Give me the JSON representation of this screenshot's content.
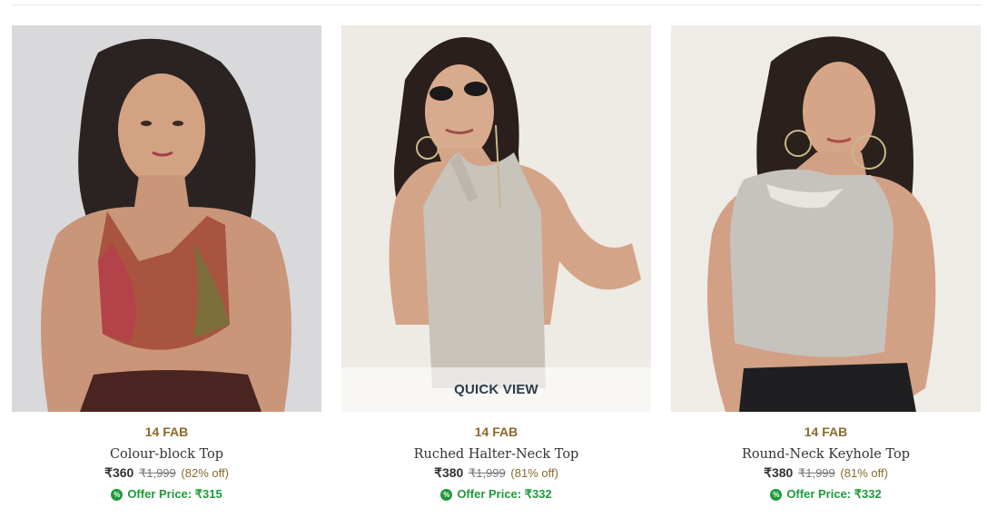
{
  "products": [
    {
      "brand": "14 FAB",
      "name": "Colour-block Top",
      "price": "₹360",
      "mrp": "₹1,999",
      "discount": "(82% off)",
      "offer_price": "Offer Price: ₹315",
      "image_icon": "product-photo-colour-block-top"
    },
    {
      "brand": "14 FAB",
      "name": "Ruched Halter-Neck Top",
      "price": "₹380",
      "mrp": "₹1,999",
      "discount": "(81% off)",
      "offer_price": "Offer Price: ₹332",
      "quick_view": "QUICK VIEW",
      "image_icon": "product-photo-ruched-halter-neck-top"
    },
    {
      "brand": "14 FAB",
      "name": "Round-Neck Keyhole Top",
      "price": "₹380",
      "mrp": "₹1,999",
      "discount": "(81% off)",
      "offer_price": "Offer Price: ₹332",
      "image_icon": "product-photo-round-neck-keyhole-top"
    }
  ],
  "offer_icon": "%",
  "colors": {
    "brand": "#8a6a2a",
    "offer": "#1f9a3a",
    "quick_view_text": "#2d3b4a"
  }
}
